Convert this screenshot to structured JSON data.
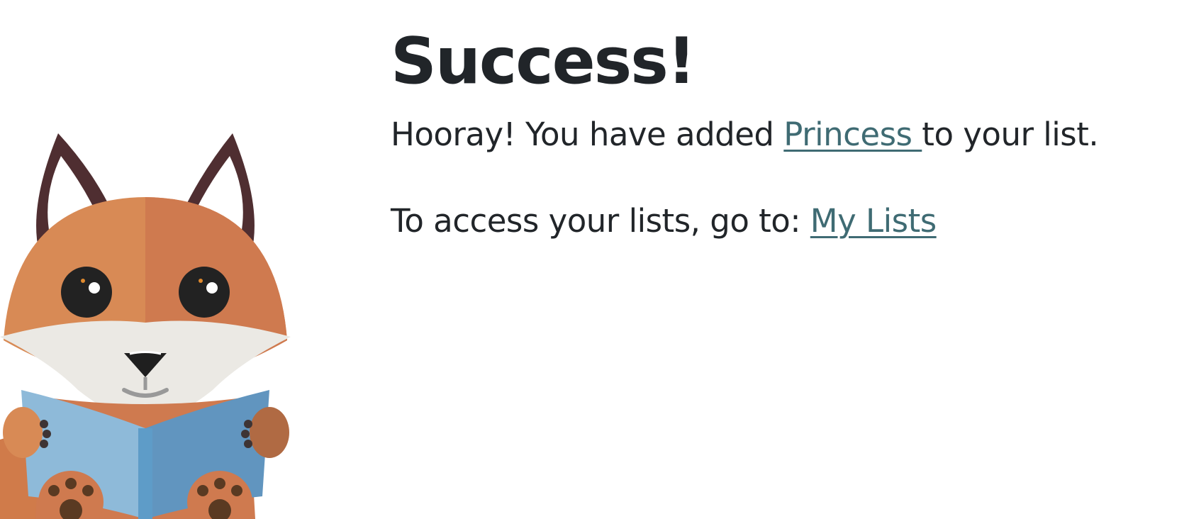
{
  "page": {
    "heading": "Success!",
    "message_prefix": "Hooray! You have added ",
    "item_link": "Princess ",
    "message_suffix": "to your list.",
    "access_prefix": "To access your lists, go to: ",
    "my_lists_link": "My Lists"
  },
  "mascot": {
    "icon": "fox-reading-book-illustration"
  },
  "colors": {
    "text": "#212529",
    "link": "#3f6b73",
    "fox_orange": "#d7874f",
    "book_blue": "#7aabd6"
  }
}
